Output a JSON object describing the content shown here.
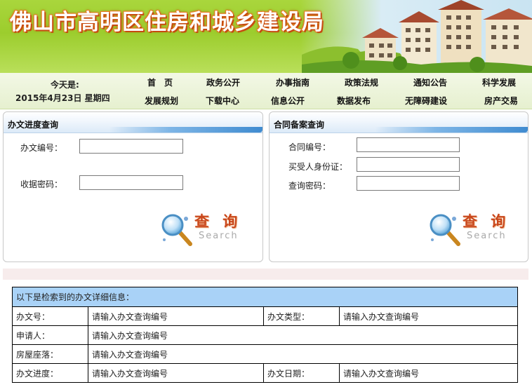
{
  "site_title": "佛山市高明区住房和城乡建设局",
  "today": {
    "label": "今天是:",
    "date": "2015年4月23日 星期四"
  },
  "nav": {
    "row1": [
      "首　页",
      "政务公开",
      "办事指南",
      "政策法规",
      "通知公告",
      "科学发展"
    ],
    "row2": [
      "发展规划",
      "下载中心",
      "信息公开",
      "数据发布",
      "无障碍建设",
      "房产交易"
    ]
  },
  "progress_panel": {
    "title": "办文进度查询",
    "fields": [
      {
        "label": "办文编号：",
        "value": ""
      },
      {
        "label": "收据密码：",
        "value": ""
      }
    ],
    "search_cn": "查 询",
    "search_en": "Search"
  },
  "contract_panel": {
    "title": "合同备案查询",
    "fields": [
      {
        "label": "合同编号：",
        "value": ""
      },
      {
        "label": "买受人身份证：",
        "value": ""
      },
      {
        "label": "查询密码：",
        "value": ""
      }
    ],
    "search_cn": "查 询",
    "search_en": "Search"
  },
  "detail": {
    "caption": "以下是检索到的办文详细信息：",
    "rows": [
      {
        "label": "办文号：",
        "value": "请输入办文查询编号",
        "label2": "办文类型：",
        "value2": "请输入办文查询编号"
      },
      {
        "label": "申请人：",
        "value": "请输入办文查询编号"
      },
      {
        "label": "房屋座落：",
        "value": "请输入办文查询编号"
      },
      {
        "label": "办文进度：",
        "value": "请输入办文查询编号",
        "label2": "办文日期：",
        "value2": "请输入办文查询编号"
      }
    ]
  },
  "colors": {
    "banner_green": "#9ccd2d",
    "title_orange": "#c74b10",
    "header_blue": "#3f8bd0",
    "caption_bg": "#a9d2f7"
  }
}
